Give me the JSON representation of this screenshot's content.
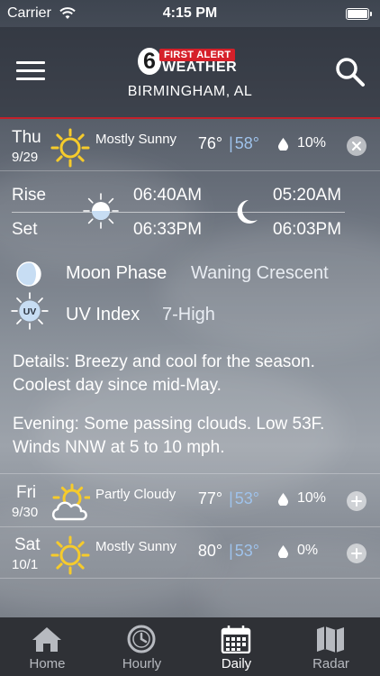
{
  "status_bar": {
    "carrier": "Carrier",
    "time": "4:15 PM"
  },
  "header": {
    "logo": {
      "number": "6",
      "first_alert": "FIRST ALERT",
      "weather": "WEATHER"
    },
    "city": "BIRMINGHAM, AL"
  },
  "today": {
    "day": "Thu",
    "date": "9/29",
    "condition": "Mostly Sunny",
    "high": "76°",
    "separator": "|",
    "low": "58°",
    "precip": "10%",
    "icon": "sun-icon"
  },
  "sun_moon": {
    "rise_label": "Rise",
    "set_label": "Set",
    "sunrise": "06:40AM",
    "sunset": "06:33PM",
    "moonrise": "05:20AM",
    "moonset": "06:03PM"
  },
  "moon_phase": {
    "label": "Moon Phase",
    "value": "Waning Crescent"
  },
  "uv_index": {
    "label": "UV Index",
    "value": "7-High",
    "badge": "UV"
  },
  "details": "Details: Breezy and cool for the season. Coolest day since mid-May.",
  "evening": "Evening: Some passing clouds. Low 53F. Winds NNW at 5 to 10 mph.",
  "forecast": [
    {
      "day": "Fri",
      "date": "9/30",
      "condition": "Partly Cloudy",
      "high": "77°",
      "separator": "|",
      "low": "53°",
      "precip": "10%",
      "icon": "partly-cloudy-icon"
    },
    {
      "day": "Sat",
      "date": "10/1",
      "condition": "Mostly Sunny",
      "high": "80°",
      "separator": "|",
      "low": "53°",
      "precip": "0%",
      "icon": "sun-icon"
    }
  ],
  "tabs": [
    {
      "label": "Home",
      "icon": "home-icon"
    },
    {
      "label": "Hourly",
      "icon": "clock-icon"
    },
    {
      "label": "Daily",
      "icon": "calendar-icon",
      "active": true
    },
    {
      "label": "Radar",
      "icon": "map-icon"
    }
  ],
  "colors": {
    "accent_red": "#c3202a",
    "low_temp_blue": "#9fc3ec",
    "sun_yellow": "#f6cb2b",
    "tabbar_bg": "#2f3136"
  }
}
